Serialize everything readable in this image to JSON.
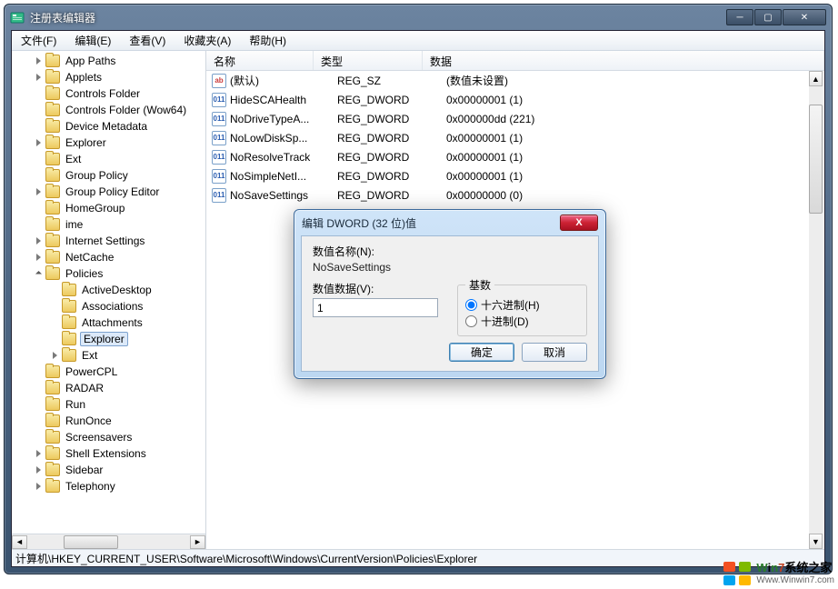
{
  "window": {
    "title": "注册表编辑器"
  },
  "menus": [
    "文件(F)",
    "编辑(E)",
    "查看(V)",
    "收藏夹(A)",
    "帮助(H)"
  ],
  "tree": [
    {
      "depth": 1,
      "exp": "closed",
      "label": "App Paths"
    },
    {
      "depth": 1,
      "exp": "closed",
      "label": "Applets"
    },
    {
      "depth": 1,
      "exp": "none",
      "label": "Controls Folder"
    },
    {
      "depth": 1,
      "exp": "none",
      "label": "Controls Folder (Wow64)"
    },
    {
      "depth": 1,
      "exp": "none",
      "label": "Device Metadata"
    },
    {
      "depth": 1,
      "exp": "closed",
      "label": "Explorer"
    },
    {
      "depth": 1,
      "exp": "none",
      "label": "Ext"
    },
    {
      "depth": 1,
      "exp": "none",
      "label": "Group Policy"
    },
    {
      "depth": 1,
      "exp": "closed",
      "label": "Group Policy Editor"
    },
    {
      "depth": 1,
      "exp": "none",
      "label": "HomeGroup"
    },
    {
      "depth": 1,
      "exp": "none",
      "label": "ime"
    },
    {
      "depth": 1,
      "exp": "closed",
      "label": "Internet Settings"
    },
    {
      "depth": 1,
      "exp": "closed",
      "label": "NetCache"
    },
    {
      "depth": 1,
      "exp": "open",
      "label": "Policies"
    },
    {
      "depth": 2,
      "exp": "none",
      "label": "ActiveDesktop"
    },
    {
      "depth": 2,
      "exp": "none",
      "label": "Associations"
    },
    {
      "depth": 2,
      "exp": "none",
      "label": "Attachments"
    },
    {
      "depth": 2,
      "exp": "none",
      "label": "Explorer",
      "selected": true
    },
    {
      "depth": 2,
      "exp": "closed",
      "label": "Ext"
    },
    {
      "depth": 1,
      "exp": "none",
      "label": "PowerCPL"
    },
    {
      "depth": 1,
      "exp": "none",
      "label": "RADAR"
    },
    {
      "depth": 1,
      "exp": "none",
      "label": "Run"
    },
    {
      "depth": 1,
      "exp": "none",
      "label": "RunOnce"
    },
    {
      "depth": 1,
      "exp": "none",
      "label": "Screensavers"
    },
    {
      "depth": 1,
      "exp": "closed",
      "label": "Shell Extensions"
    },
    {
      "depth": 1,
      "exp": "closed",
      "label": "Sidebar"
    },
    {
      "depth": 1,
      "exp": "closed",
      "label": "Telephony"
    }
  ],
  "list": {
    "headers": {
      "name": "名称",
      "type": "类型",
      "data": "数据"
    },
    "rows": [
      {
        "icon": "sz",
        "name": "(默认)",
        "type": "REG_SZ",
        "data": "(数值未设置)"
      },
      {
        "icon": "dw",
        "name": "HideSCAHealth",
        "type": "REG_DWORD",
        "data": "0x00000001 (1)"
      },
      {
        "icon": "dw",
        "name": "NoDriveTypeA...",
        "type": "REG_DWORD",
        "data": "0x000000dd (221)"
      },
      {
        "icon": "dw",
        "name": "NoLowDiskSp...",
        "type": "REG_DWORD",
        "data": "0x00000001 (1)"
      },
      {
        "icon": "dw",
        "name": "NoResolveTrack",
        "type": "REG_DWORD",
        "data": "0x00000001 (1)"
      },
      {
        "icon": "dw",
        "name": "NoSimpleNetI...",
        "type": "REG_DWORD",
        "data": "0x00000001 (1)"
      },
      {
        "icon": "dw",
        "name": "NoSaveSettings",
        "type": "REG_DWORD",
        "data": "0x00000000 (0)"
      }
    ]
  },
  "status": "计算机\\HKEY_CURRENT_USER\\Software\\Microsoft\\Windows\\CurrentVersion\\Policies\\Explorer",
  "dialog": {
    "title": "编辑 DWORD (32 位)值",
    "name_label": "数值名称(N):",
    "name_value": "NoSaveSettings",
    "data_label": "数值数据(V):",
    "data_value": "1",
    "base_label": "基数",
    "radio_hex": "十六进制(H)",
    "radio_dec": "十进制(D)",
    "ok": "确定",
    "cancel": "取消"
  },
  "watermark": {
    "line1_a": "W",
    "line1_b": "i",
    "line1_c": "n",
    "line1_seven": "7",
    "line1_d": "系统之家",
    "line2": "Www.Winwin7.com"
  }
}
